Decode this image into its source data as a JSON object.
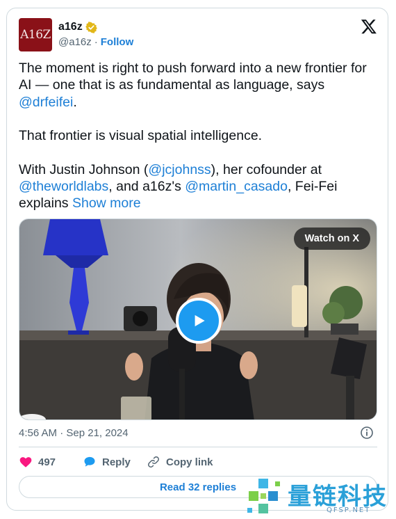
{
  "author": {
    "avatar_text": "A16Z",
    "display_name": "a16z",
    "handle": "@a16z",
    "separator": "·",
    "follow_label": "Follow"
  },
  "tweet": {
    "line1": "The moment is right to push forward into a new frontier for AI — one that is as fundamental as language, says ",
    "mention_drfeifei": "@drfeifei",
    "line1_end": ".",
    "para2": "That frontier is visual spatial intelligence.",
    "para3_start": "With Justin Johnson (",
    "mention_jcjohnss": "@jcjohnss",
    "para3_mid1": "), her cofounder at ",
    "mention_theworldlabs": "@theworldlabs",
    "para3_mid2": ", and a16z's ",
    "mention_martin": "@martin_casado",
    "para3_end": ", Fei-Fei explains ",
    "show_more": "Show more"
  },
  "media": {
    "watch_label": "Watch on X"
  },
  "meta": {
    "timestamp": "4:56 AM · Sep 21, 2024"
  },
  "actions": {
    "like_count": "497",
    "reply_label": "Reply",
    "copy_link_label": "Copy link"
  },
  "footer": {
    "read_replies_label": "Read 32 replies"
  },
  "watermark": {
    "text": "量链科技",
    "sub": "QFSP.NET"
  },
  "colors": {
    "accent": "#1d9bf0",
    "link": "#1d7fd6",
    "like": "#f91880",
    "muted": "#536471",
    "brand": "#8a1118"
  },
  "icons": {
    "verified": "verified-badge-icon",
    "x_logo": "x-logo-icon",
    "play": "play-icon",
    "info": "info-icon",
    "heart": "heart-icon",
    "reply": "reply-bubble-icon",
    "link": "link-icon"
  }
}
